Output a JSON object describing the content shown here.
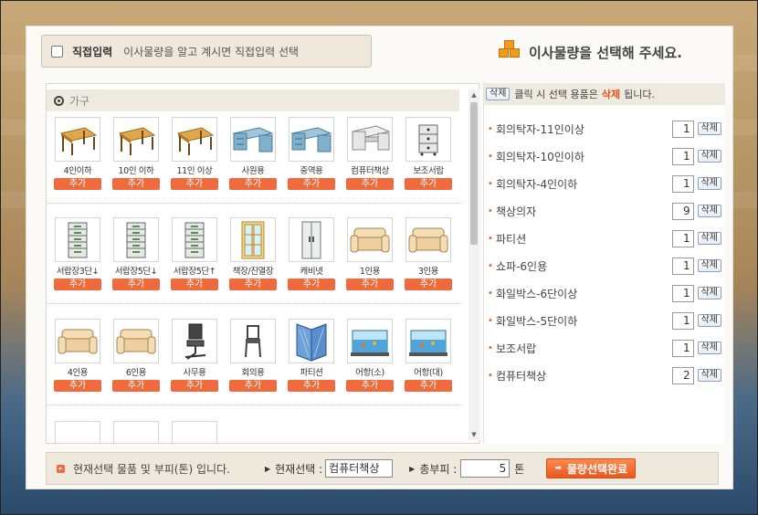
{
  "header": {
    "direct_input_label": "직접입력",
    "direct_input_desc": "이사물량을 알고 계시면 직접입력 선택",
    "title": "이사물량을 선택해 주세요."
  },
  "category": {
    "label": "가구"
  },
  "add_label": "추가",
  "furniture_rows": [
    [
      {
        "name": "4인이하",
        "icon": "table-icon"
      },
      {
        "name": "10인 이하",
        "icon": "table-icon"
      },
      {
        "name": "11인 이상",
        "icon": "table-icon"
      },
      {
        "name": "사원용",
        "icon": "desk-icon"
      },
      {
        "name": "중역용",
        "icon": "desk-icon"
      },
      {
        "name": "컴퓨터책상",
        "icon": "computer-desk-icon"
      },
      {
        "name": "보조서랍",
        "icon": "drawer-icon"
      }
    ],
    [
      {
        "name": "서랍장3단↓",
        "icon": "cabinet-icon"
      },
      {
        "name": "서랍장5단↓",
        "icon": "cabinet-icon"
      },
      {
        "name": "서랍장5단↑",
        "icon": "cabinet-icon"
      },
      {
        "name": "책장/진열장",
        "icon": "bookcase-icon"
      },
      {
        "name": "캐비넷",
        "icon": "locker-icon"
      },
      {
        "name": "1인용",
        "icon": "sofa-icon"
      },
      {
        "name": "3인용",
        "icon": "sofa-icon"
      }
    ],
    [
      {
        "name": "4인용",
        "icon": "sofa-icon"
      },
      {
        "name": "6인용",
        "icon": "sofa-icon"
      },
      {
        "name": "사무용",
        "icon": "office-chair-icon"
      },
      {
        "name": "회의용",
        "icon": "chair-icon"
      },
      {
        "name": "파티션",
        "icon": "partition-icon"
      },
      {
        "name": "어항(소)",
        "icon": "fishtank-icon"
      },
      {
        "name": "어항(대)",
        "icon": "fishtank-icon"
      }
    ]
  ],
  "right": {
    "note_delete": "삭제",
    "note_text_before": "클릭 시 선택 용품은",
    "note_text_red": "삭제",
    "note_text_after": "됩니다.",
    "delete_label": "삭제",
    "selected": [
      {
        "name": "회의탁자-11인이상",
        "qty": "1"
      },
      {
        "name": "회의탁자-10인이하",
        "qty": "1"
      },
      {
        "name": "회의탁자-4인이하",
        "qty": "1"
      },
      {
        "name": "책상의자",
        "qty": "9"
      },
      {
        "name": "파티션",
        "qty": "1"
      },
      {
        "name": "쇼파-6인용",
        "qty": "1"
      },
      {
        "name": "화일박스-6단이상",
        "qty": "1"
      },
      {
        "name": "화일박스-5단이하",
        "qty": "1"
      },
      {
        "name": "보조서랍",
        "qty": "1"
      },
      {
        "name": "컴퓨터책상",
        "qty": "2"
      }
    ]
  },
  "bottom": {
    "info": "현재선택 물품 및 부피(톤) 입니다.",
    "current_label": "현재선택 :",
    "current_value": "컴퓨터책상",
    "total_label": "총부피 :",
    "total_value": "5",
    "unit": "톤",
    "complete_button": "물량선택완료"
  }
}
